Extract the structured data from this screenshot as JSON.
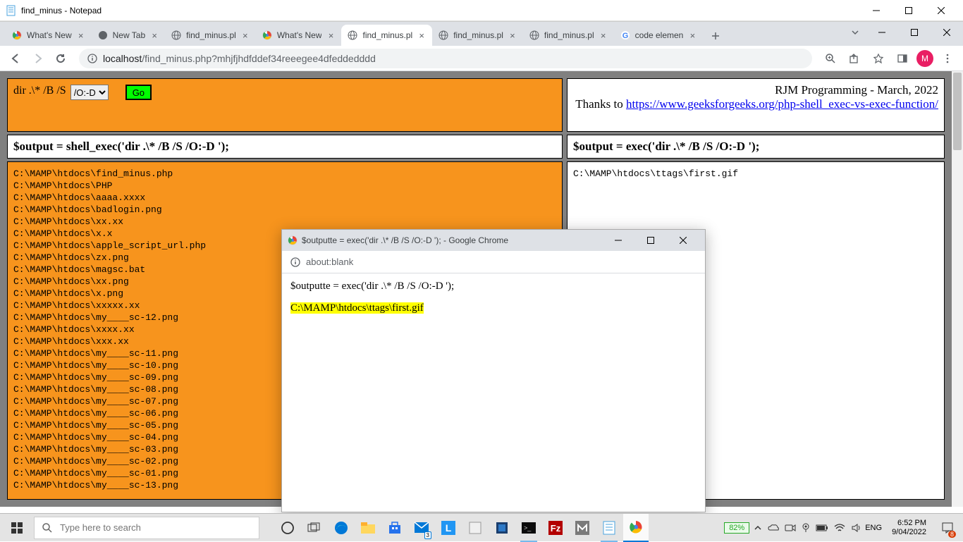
{
  "notepad": {
    "title": "find_minus - Notepad"
  },
  "chrome": {
    "tabs": [
      {
        "title": "What's New",
        "favicon": "chrome"
      },
      {
        "title": "New Tab",
        "favicon": "chrome-dark"
      },
      {
        "title": "find_minus.pl",
        "favicon": "globe"
      },
      {
        "title": "What's New",
        "favicon": "chrome-color"
      },
      {
        "title": "find_minus.pl",
        "favicon": "globe",
        "active": true
      },
      {
        "title": "find_minus.pl",
        "favicon": "globe"
      },
      {
        "title": "find_minus.pl",
        "favicon": "globe"
      },
      {
        "title": "code elemen",
        "favicon": "google"
      }
    ],
    "url_host": "localhost",
    "url_path": "/find_minus.php?mhjfjhdfddef34reeegee4dfeddedddd",
    "avatar_letter": "M"
  },
  "page": {
    "dir_prefix": "dir .\\* /B /S ",
    "dir_select": "/O:-D",
    "go_label": "Go",
    "credit_line1": "RJM Programming - March, 2022",
    "credit_prefix": "Thanks to ",
    "credit_link": "https://www.geeksforgeeks.org/php-shell_exec-vs-exec-function/",
    "cmd_left": "$output = shell_exec('dir .\\* /B /S /O:-D ');",
    "cmd_right": "$output = exec('dir .\\* /B /S /O:-D ');",
    "output_left": "C:\\MAMP\\htdocs\\find_minus.php\nC:\\MAMP\\htdocs\\PHP\nC:\\MAMP\\htdocs\\aaaa.xxxx\nC:\\MAMP\\htdocs\\badlogin.png\nC:\\MAMP\\htdocs\\xx.xx\nC:\\MAMP\\htdocs\\x.x\nC:\\MAMP\\htdocs\\apple_script_url.php\nC:\\MAMP\\htdocs\\zx.png\nC:\\MAMP\\htdocs\\magsc.bat\nC:\\MAMP\\htdocs\\xx.png\nC:\\MAMP\\htdocs\\x.png\nC:\\MAMP\\htdocs\\xxxxx.xx\nC:\\MAMP\\htdocs\\my____sc-12.png\nC:\\MAMP\\htdocs\\xxxx.xx\nC:\\MAMP\\htdocs\\xxx.xx\nC:\\MAMP\\htdocs\\my____sc-11.png\nC:\\MAMP\\htdocs\\my____sc-10.png\nC:\\MAMP\\htdocs\\my____sc-09.png\nC:\\MAMP\\htdocs\\my____sc-08.png\nC:\\MAMP\\htdocs\\my____sc-07.png\nC:\\MAMP\\htdocs\\my____sc-06.png\nC:\\MAMP\\htdocs\\my____sc-05.png\nC:\\MAMP\\htdocs\\my____sc-04.png\nC:\\MAMP\\htdocs\\my____sc-03.png\nC:\\MAMP\\htdocs\\my____sc-02.png\nC:\\MAMP\\htdocs\\my____sc-01.png\nC:\\MAMP\\htdocs\\my____sc-13.png",
    "output_right": "C:\\MAMP\\htdocs\\ttags\\first.gif"
  },
  "popup": {
    "title": "$outputte = exec('dir .\\* /B /S /O:-D '); - Google Chrome",
    "address": "about:blank",
    "cmd": "$outputte = exec('dir .\\* /B /S /O:-D ');",
    "highlight": "C:\\MAMP\\htdocs\\ttags\\first.gif"
  },
  "taskbar": {
    "search_placeholder": "Type here to search",
    "battery": "82%",
    "lang": "ENG",
    "time": "6:52 PM",
    "date": "9/04/2022",
    "notif_count": "8"
  }
}
